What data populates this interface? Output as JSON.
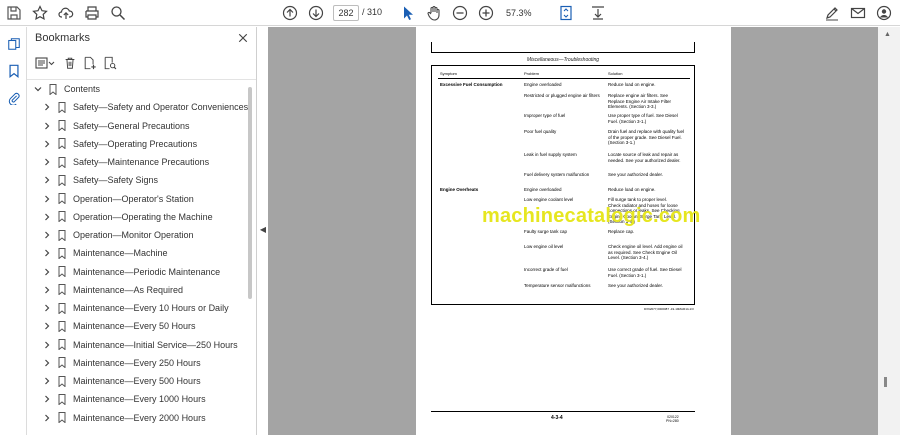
{
  "toolbar": {
    "page_current": "282",
    "page_total": "/ 310",
    "zoom": "57.3%"
  },
  "bookmarks": {
    "title": "Bookmarks",
    "items": [
      "Contents",
      "Safety—Safety and Operator Conveniences",
      "Safety—General Precautions",
      "Safety—Operating Precautions",
      "Safety—Maintenance Precautions",
      "Safety—Safety Signs",
      "Operation—Operator's Station",
      "Operation—Operating the Machine",
      "Operation—Monitor Operation",
      "Maintenance—Machine",
      "Maintenance—Periodic Maintenance",
      "Maintenance—As Required",
      "Maintenance—Every 10 Hours or Daily",
      "Maintenance—Every 50 Hours",
      "Maintenance—Initial Service—250 Hours",
      "Maintenance—Every 250 Hours",
      "Maintenance—Every 500 Hours",
      "Maintenance—Every 1000 Hours",
      "Maintenance—Every 2000 Hours"
    ]
  },
  "document": {
    "header": "Miscellaneous—Troubleshooting",
    "col_symptom": "Symptom",
    "col_problem": "Problem",
    "col_solution": "Solution",
    "rows": [
      {
        "symptom": "Excessive Fuel Consumption",
        "problem": "Engine overloaded",
        "solution": "Reduce load on engine."
      },
      {
        "symptom": "",
        "problem": "Restricted or plugged engine air filters",
        "solution": "Replace engine air filters.  See\nReplace Engine Air Intake Filter\nElements. (Section 3-3.)"
      },
      {
        "symptom": "",
        "problem": "Improper type of fuel",
        "solution": "Use proper type of fuel.  See Diesel\nFuel. (Section 3-1.)"
      },
      {
        "symptom": "",
        "problem": "Poor fuel quality",
        "solution": "Drain fuel and replace with quality fuel\nof the proper grade.  See Diesel Fuel.\n(Section 3-1.)"
      },
      {
        "symptom": "",
        "problem": "Leak in fuel supply system",
        "solution": "Locate source of leak and repair as\nneeded. See your authorized dealer."
      },
      {
        "symptom": "",
        "problem": "Fuel delivery system malfunction",
        "solution": "See your authorized dealer."
      },
      {
        "symptom": "Engine Overheats",
        "problem": "Engine overloaded",
        "solution": "Reduce load on engine."
      },
      {
        "symptom": "",
        "problem": "Low engine coolant level",
        "solution": "Fill surge tank to proper level.\nCheck radiator and hoses for loose\nconnections or leaks. See Checking\nEngine Coolant Surge Tank Level.\n(Section 3-4.)"
      },
      {
        "symptom": "",
        "problem": "Faulty surge tank cap",
        "solution": "Replace cap."
      },
      {
        "symptom": "",
        "problem": "Low engine oil level",
        "solution": "Check engine oil level. Add engine oil\nas required.  See Check Engine Oil\nLevel.  (Section 3-4.)"
      },
      {
        "symptom": "",
        "problem": "Incorrect grade of fuel",
        "solution": "Use correct grade of fuel.  See Diesel\nFuel. (Section 3-1.)"
      },
      {
        "symptom": "",
        "problem": "Temperature sensor malfunctions",
        "solution": "See your authorized dealer."
      }
    ],
    "watermark": "machinecatalogic.com",
    "code": "DX92077,0000087 -19-19MAR14-1/3",
    "page_number": "4-3-4",
    "footer_right": "020122\nPN=280"
  }
}
